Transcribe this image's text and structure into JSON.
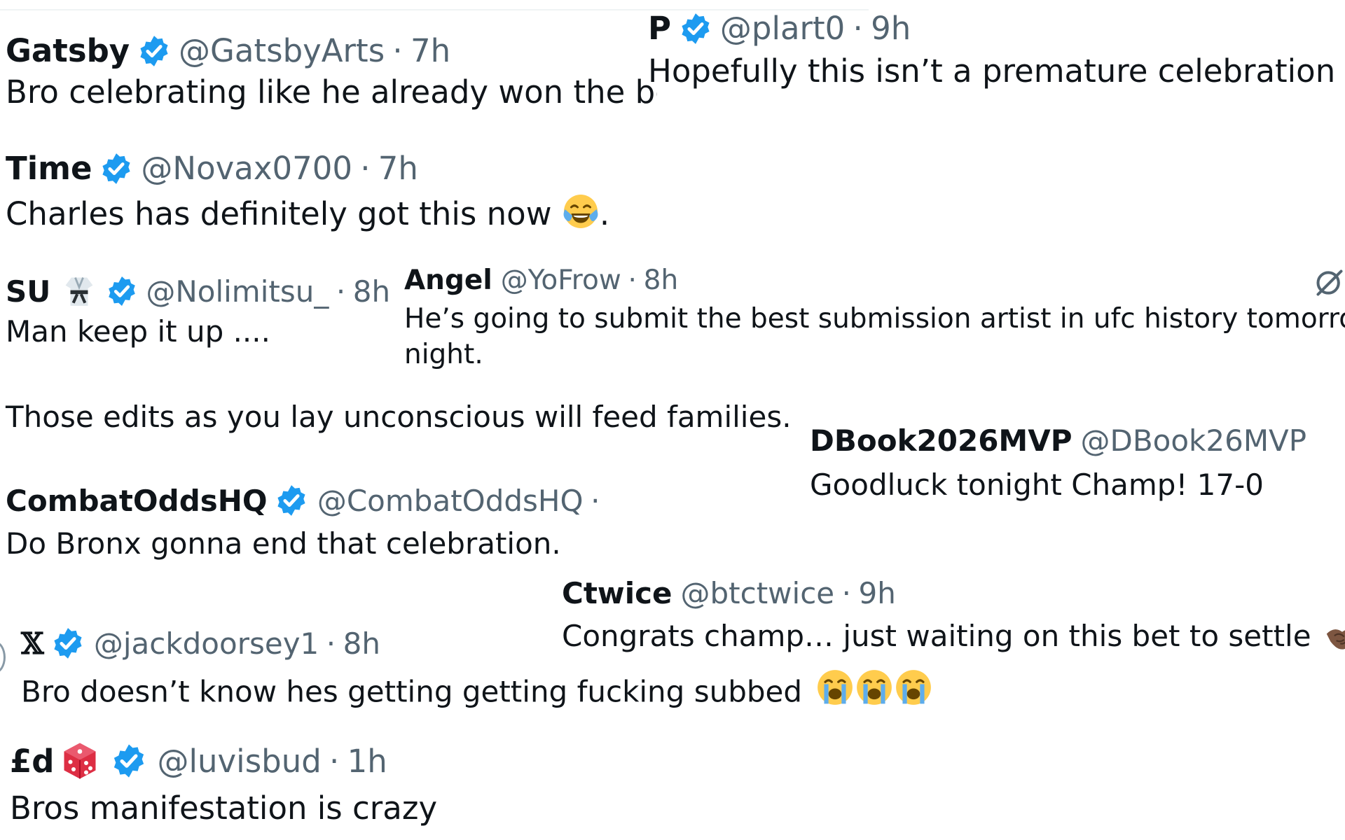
{
  "tweets": [
    {
      "name": "Gatsby",
      "handle": "@GatsbyArts",
      "time": "7h",
      "text": "Bro celebrating like he already won the bel"
    },
    {
      "name": "P",
      "handle": "@plart0",
      "time": "9h",
      "text": "Hopefully this isn’t a premature celebration"
    },
    {
      "name": "Time",
      "handle": "@Novax0700",
      "time": "7h",
      "text": "Charles has definitely got this now",
      "text_after": "."
    },
    {
      "name": "SU",
      "handle": "@Nolimitsu_",
      "time": "8h",
      "text": "Man keep it up ...."
    },
    {
      "name": "Angel",
      "handle": "@YoFrow",
      "time": "8h",
      "text": "He’s going to submit the best submission artist in ufc history tomorrow",
      "text2": "night."
    },
    {
      "text": "Those edits as you lay unconscious will feed families."
    },
    {
      "name": "DBook2026MVP",
      "handle": "@DBook26MVP",
      "text": "Goodluck tonight Champ! 17-0"
    },
    {
      "name": "CombatOddsHQ",
      "handle": "@CombatOddsHQ",
      "text": "Do Bronx gonna end that celebration."
    },
    {
      "name": "Ctwice",
      "handle": "@btctwice",
      "time": "9h",
      "text": "Congrats champ… just waiting on this bet to settle"
    },
    {
      "name": "𝕏",
      "handle": "@jackdoorsey1",
      "time": "8h",
      "text": "Bro doesn’t know hes getting getting fucking subbed"
    },
    {
      "name": "£d",
      "handle": "@luvisbud",
      "time": "1h",
      "text": "Bros manifestation is crazy"
    }
  ],
  "separator": "·",
  "icons": {
    "verified": "verified-badge-icon",
    "verified_color": "#1d9bf0",
    "laugh": "face-with-tears-of-joy-emoji",
    "cry": "loudly-crying-face-emoji",
    "handshake": "handshake-emoji",
    "die": "game-die-emoji",
    "gi": "martial-arts-uniform-emoji",
    "grok": "grok-icon"
  }
}
